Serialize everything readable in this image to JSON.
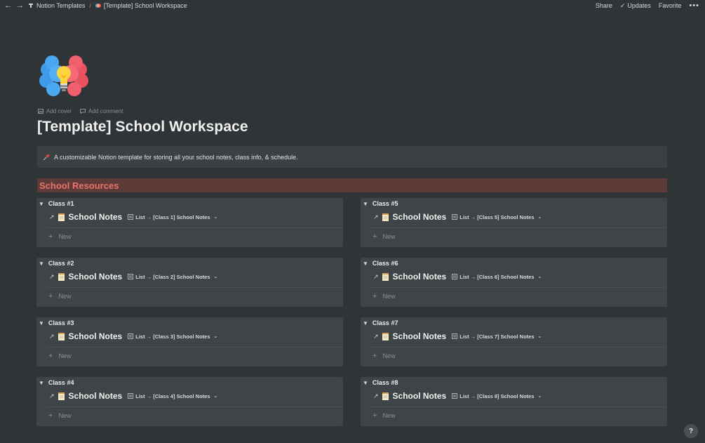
{
  "topbar": {
    "breadcrumbs": [
      "Notion Templates",
      "[Template] School Workspace"
    ],
    "share": "Share",
    "updates": "Updates",
    "favorite": "Favorite",
    "more": "•••"
  },
  "page": {
    "add_cover": "Add cover",
    "add_comment": "Add comment",
    "title": "[Template] School Workspace",
    "callout": "A customizable Notion template for storing all your school notes, class info, & schedule.",
    "section": "School Resources"
  },
  "classes": [
    {
      "label": "Class #1",
      "db_title": "School Notes",
      "view": "List → [Class 1] School Notes",
      "new": "New"
    },
    {
      "label": "Class #2",
      "db_title": "School Notes",
      "view": "List → [Class 2] School Notes",
      "new": "New"
    },
    {
      "label": "Class #3",
      "db_title": "School Notes",
      "view": "List → [Class 3] School Notes",
      "new": "New"
    },
    {
      "label": "Class #4",
      "db_title": "School Notes",
      "view": "List → [Class 4] School Notes",
      "new": "New"
    },
    {
      "label": "Class #5",
      "db_title": "School Notes",
      "view": "List → [Class 5] School Notes",
      "new": "New"
    },
    {
      "label": "Class #6",
      "db_title": "School Notes",
      "view": "List → [Class 6] School Notes",
      "new": "New"
    },
    {
      "label": "Class #7",
      "db_title": "School Notes",
      "view": "List → [Class 7] School Notes",
      "new": "New"
    },
    {
      "label": "Class #8",
      "db_title": "School Notes",
      "view": "List → [Class 8] School Notes",
      "new": "New"
    }
  ],
  "help": "?"
}
